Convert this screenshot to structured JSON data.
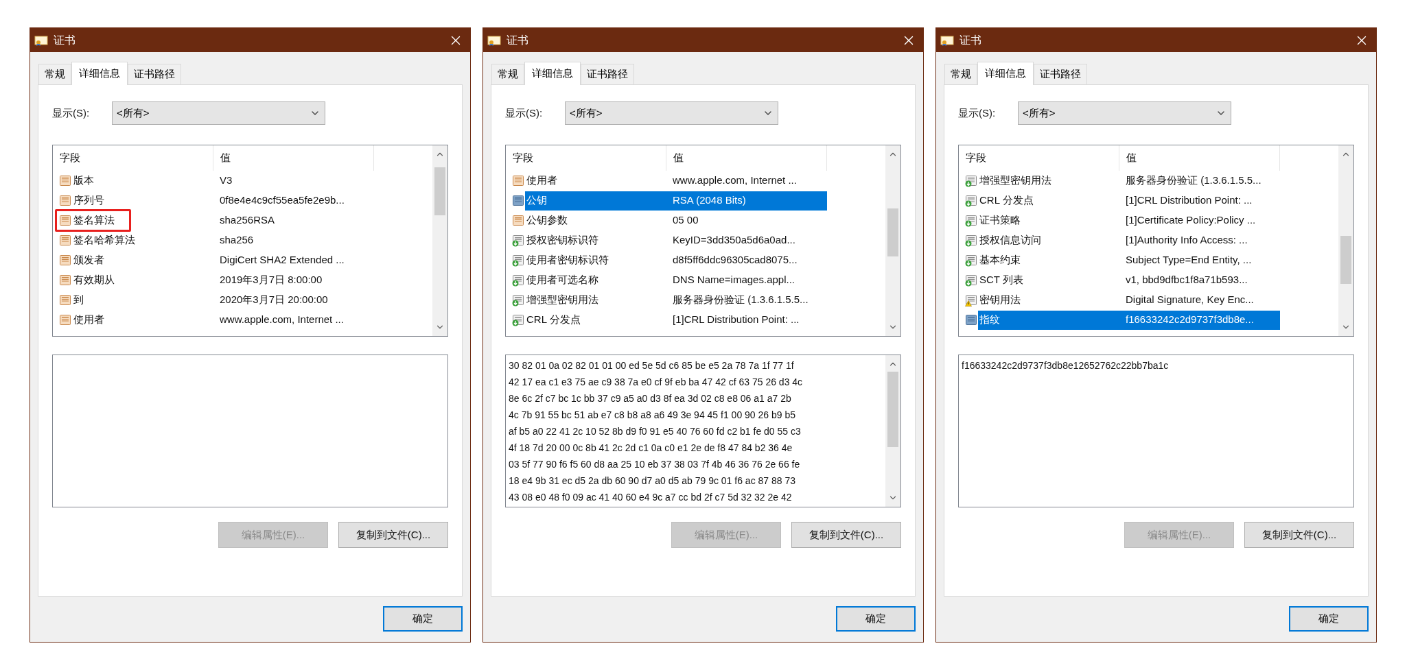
{
  "dialogs": [
    {
      "title": "证书",
      "tabs": [
        {
          "label": "常规",
          "selected": false
        },
        {
          "label": "详细信息",
          "selected": true
        },
        {
          "label": "证书路径",
          "selected": false
        }
      ],
      "show_label": "显示(S):",
      "show_value": "<所有>",
      "columns": [
        "字段",
        "值"
      ],
      "rows": [
        {
          "kind": "field",
          "field": "版本",
          "value": "V3",
          "selected": false,
          "annotated": false
        },
        {
          "kind": "field",
          "field": "序列号",
          "value": "0f8e4e4c9cf55ea5fe2e9b...",
          "selected": false,
          "annotated": false
        },
        {
          "kind": "field",
          "field": "签名算法",
          "value": "sha256RSA",
          "selected": false,
          "annotated": true
        },
        {
          "kind": "field",
          "field": "签名哈希算法",
          "value": "sha256",
          "selected": false,
          "annotated": false
        },
        {
          "kind": "field",
          "field": "颁发者",
          "value": "DigiCert SHA2 Extended ...",
          "selected": false,
          "annotated": false
        },
        {
          "kind": "field",
          "field": "有效期从",
          "value": "2019年3月7日 8:00:00",
          "selected": false,
          "annotated": false
        },
        {
          "kind": "field",
          "field": "到",
          "value": "2020年3月7日 20:00:00",
          "selected": false,
          "annotated": false
        },
        {
          "kind": "field",
          "field": "使用者",
          "value": "www.apple.com, Internet ...",
          "selected": false,
          "annotated": false
        }
      ],
      "buttons": [
        {
          "label": "编辑属性(E)...",
          "disabled": true
        },
        {
          "label": "复制到文件(C)...",
          "disabled": false
        }
      ],
      "ok_button": "确定"
    },
    {
      "title": "证书",
      "tabs": [
        {
          "label": "常规",
          "selected": false
        },
        {
          "label": "详细信息",
          "selected": true
        },
        {
          "label": "证书路径",
          "selected": false
        }
      ],
      "show_label": "显示(S):",
      "show_value": "<所有>",
      "columns": [
        "字段",
        "值"
      ],
      "rows": [
        {
          "kind": "field",
          "field": "使用者",
          "value": "www.apple.com, Internet ...",
          "selected": false,
          "annotated": false
        },
        {
          "kind": "field",
          "field": "公钥",
          "value": "RSA (2048 Bits)",
          "selected": true,
          "annotated": false
        },
        {
          "kind": "field",
          "field": "公钥参数",
          "value": "05 00",
          "selected": false,
          "annotated": false
        },
        {
          "kind": "extension",
          "field": "授权密钥标识符",
          "value": "KeyID=3dd350a5d6a0ad...",
          "selected": false,
          "annotated": false
        },
        {
          "kind": "extension",
          "field": "使用者密钥标识符",
          "value": "d8f5ff6ddc96305cad8075...",
          "selected": false,
          "annotated": false
        },
        {
          "kind": "extension",
          "field": "使用者可选名称",
          "value": "DNS Name=images.appl...",
          "selected": false,
          "annotated": false
        },
        {
          "kind": "extension",
          "field": "增强型密钥用法",
          "value": "服务器身份验证 (1.3.6.1.5.5...",
          "selected": false,
          "annotated": false
        },
        {
          "kind": "extension",
          "field": "CRL 分发点",
          "value": "[1]CRL Distribution Point: ...",
          "selected": false,
          "annotated": false
        }
      ],
      "detail_lines": [
        "30 82 01 0a 02 82 01 01 00 ed 5e 5d c6 85 be e5 2a 78 7a 1f 77 1f",
        "42 17 ea c1 e3 75 ae c9 38 7a e0 cf 9f eb ba 47 42 cf 63 75 26 d3 4c",
        "8e 6c 2f c7 bc 1c bb 37 c9 a5 a0 d3 8f ea 3d 02 c8 e8 06 a1 a7 2b",
        "4c 7b 91 55 bc 51 ab e7 c8 b8 a8 a6 49 3e 94 45 f1 00 90 26 b9 b5",
        "af b5 a0 22 41 2c 10 52 8b d9 f0 91 e5 40 76 60 fd c2 b1 fe d0 55 c3",
        "4f 18 7d 20 00 0c 8b 41 2c 2d c1 0a c0 e1 2e de f8 47 84 b2 36 4e",
        "03 5f 77 90 f6 f5 60 d8 aa 25 10 eb 37 38 03 7f 4b 46 36 76 2e 66 fe",
        "18 e4 9b 31 ec d5 2a db 60 90 d7 a0 d5 ab 79 9c 01 f6 ac 87 88 73",
        "43 08 e0 48 f0 09 ac 41 40 60 e4 9c a7 cc bd 2f c7 5d 32 32 2e 42"
      ],
      "buttons": [
        {
          "label": "编辑属性(E)...",
          "disabled": true
        },
        {
          "label": "复制到文件(C)...",
          "disabled": false
        }
      ],
      "ok_button": "确定"
    },
    {
      "title": "证书",
      "tabs": [
        {
          "label": "常规",
          "selected": false
        },
        {
          "label": "详细信息",
          "selected": true
        },
        {
          "label": "证书路径",
          "selected": false
        }
      ],
      "show_label": "显示(S):",
      "show_value": "<所有>",
      "columns": [
        "字段",
        "值"
      ],
      "rows": [
        {
          "kind": "extension",
          "field": "增强型密钥用法",
          "value": "服务器身份验证 (1.3.6.1.5.5...",
          "selected": false,
          "annotated": false
        },
        {
          "kind": "extension",
          "field": "CRL 分发点",
          "value": "[1]CRL Distribution Point: ...",
          "selected": false,
          "annotated": false
        },
        {
          "kind": "extension",
          "field": "证书策略",
          "value": "[1]Certificate Policy:Policy ...",
          "selected": false,
          "annotated": false
        },
        {
          "kind": "extension",
          "field": "授权信息访问",
          "value": "[1]Authority Info Access: ...",
          "selected": false,
          "annotated": false
        },
        {
          "kind": "extension",
          "field": "基本约束",
          "value": "Subject Type=End Entity, ...",
          "selected": false,
          "annotated": false
        },
        {
          "kind": "extension",
          "field": "SCT 列表",
          "value": "v1, bbd9dfbc1f8a71b593...",
          "selected": false,
          "annotated": false
        },
        {
          "kind": "critical",
          "field": "密钥用法",
          "value": "Digital Signature, Key Enc...",
          "selected": false,
          "annotated": false
        },
        {
          "kind": "field",
          "field": "指纹",
          "value": "f16633242c2d9737f3db8e...",
          "selected": true,
          "annotated": false
        }
      ],
      "detail_lines": [
        "f16633242c2d9737f3db8e12652762c22bb7ba1c"
      ],
      "buttons": [
        {
          "label": "编辑属性(E)...",
          "disabled": true
        },
        {
          "label": "复制到文件(C)...",
          "disabled": false
        }
      ],
      "ok_button": "确定"
    }
  ]
}
